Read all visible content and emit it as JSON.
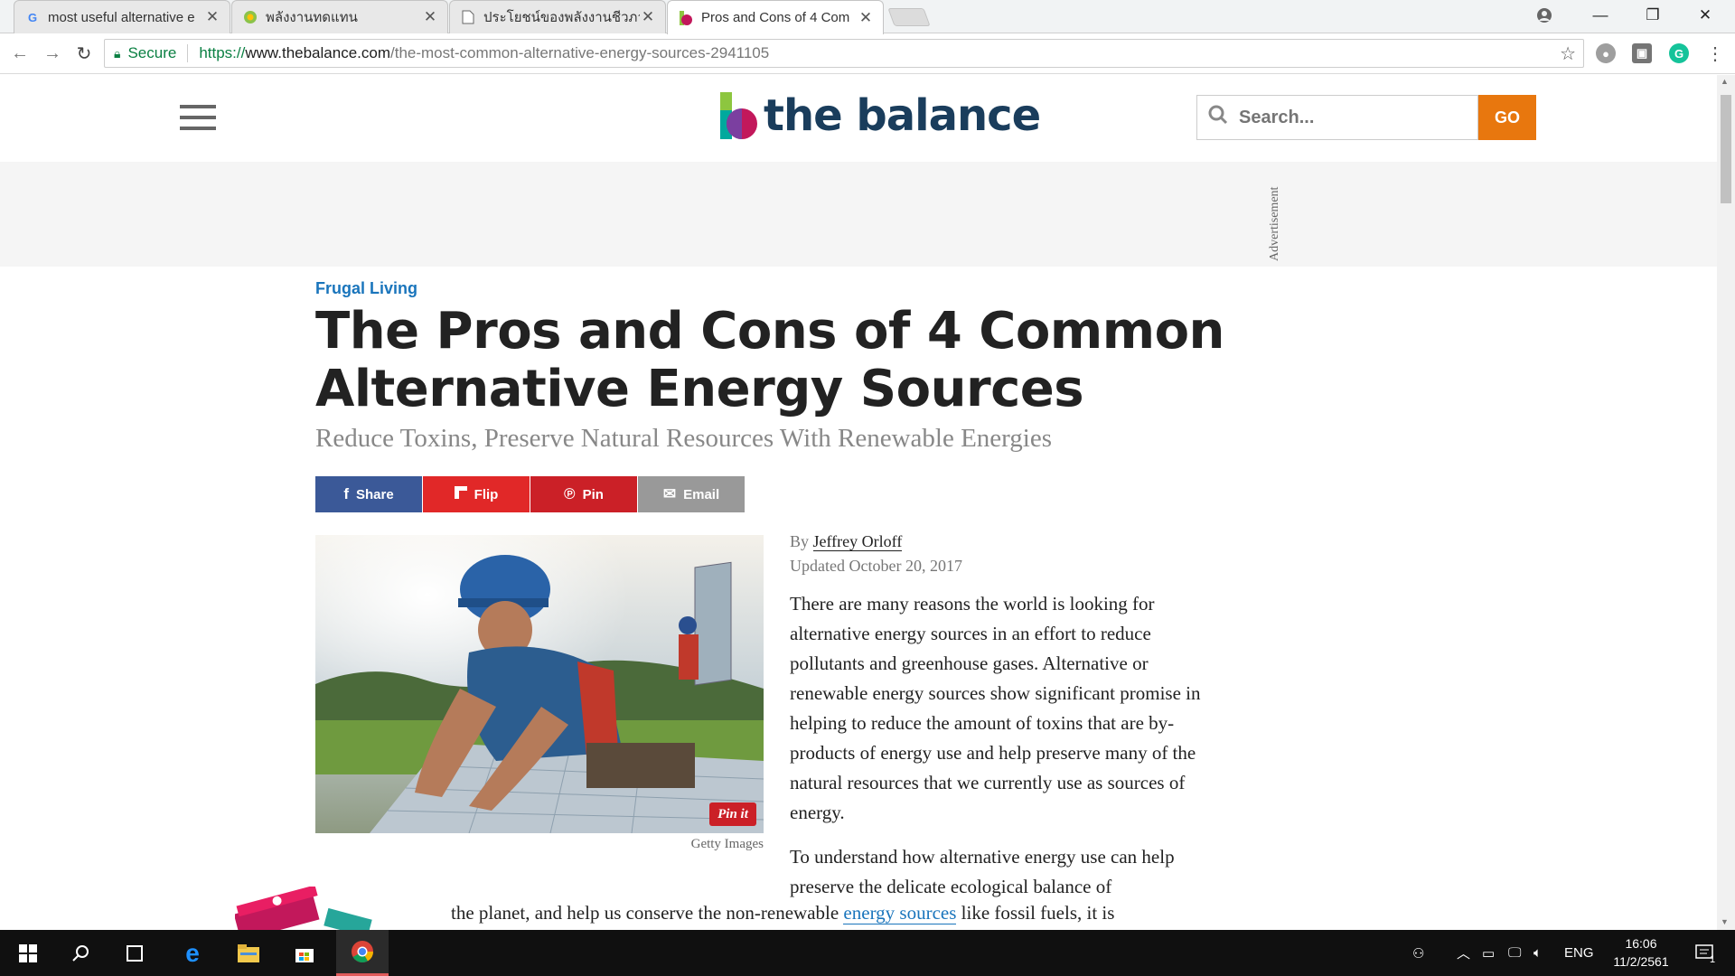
{
  "browser": {
    "tabs": [
      {
        "title": "most useful alternative e",
        "favicon": "google-icon",
        "active": false
      },
      {
        "title": "พลังงานทดแทน",
        "favicon": "thai-site-icon",
        "active": false
      },
      {
        "title": "ประโยชน์ของพลังงานชีวภาพ",
        "favicon": "document-icon",
        "active": false
      },
      {
        "title": "Pros and Cons of 4 Com",
        "favicon": "the-balance-icon",
        "active": true
      }
    ],
    "address": {
      "secure_label": "Secure",
      "url_proto": "https://",
      "url_host": "www.thebalance.com",
      "url_path": "/the-most-common-alternative-energy-sources-2941105"
    }
  },
  "site": {
    "logo_text": "the balance",
    "search_placeholder": "Search...",
    "go_label": "GO",
    "ad_label": "Advertisement"
  },
  "article": {
    "category": "Frugal Living",
    "title": "The Pros and Cons of 4 Common Alternative Energy Sources",
    "subtitle": "Reduce Toxins, Preserve Natural Resources With Renewable Energies",
    "share_buttons": [
      {
        "label": "Share",
        "icon": "facebook-icon",
        "color": "#3b5998"
      },
      {
        "label": "Flip",
        "icon": "flipboard-icon",
        "color": "#e12828"
      },
      {
        "label": "Pin",
        "icon": "pinterest-icon",
        "color": "#cb2027"
      },
      {
        "label": "Email",
        "icon": "email-icon",
        "color": "#999999"
      }
    ],
    "pin_it_label": "Pin it",
    "image_credit": "Getty Images",
    "by_prefix": "By",
    "author": "Jeffrey Orloff",
    "updated": "Updated October 20, 2017",
    "paragraph_1": "There are many reasons the world is looking for alternative energy sources in an effort to reduce pollutants and greenhouse gases. Alternative or renewable energy sources show significant promise in helping to reduce the amount of toxins that are by-products of energy use and help preserve many of the natural resources that we currently use as sources of energy.",
    "paragraph_2": "To understand how alternative energy use can help preserve the delicate ecological balance of",
    "paragraph_2_cont_before": "the planet, and help us conserve the non-renewable",
    "paragraph_2_link": "energy sources",
    "paragraph_2_cont_after": "like fossil fuels, it is"
  },
  "taskbar": {
    "language": "ENG",
    "time": "16:06",
    "date": "11/2/2561",
    "notification_count": "1"
  },
  "colors": {
    "accent_orange": "#e8770e",
    "category_blue": "#1a75bc",
    "logo_navy": "#1a3d5c"
  }
}
